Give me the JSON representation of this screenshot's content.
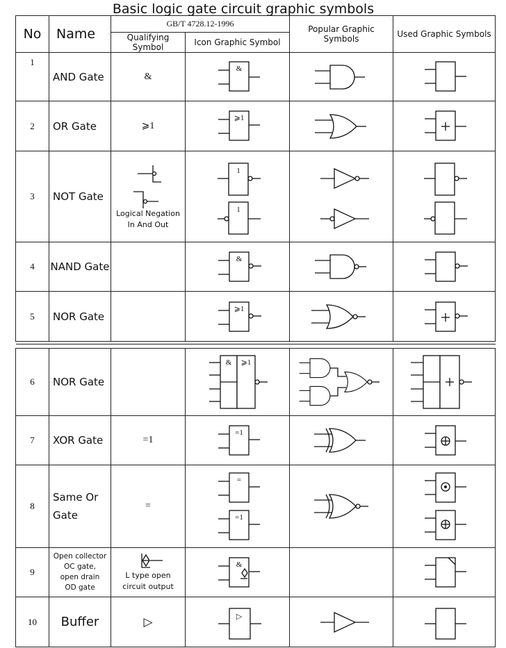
{
  "title": "Basic logic gate circuit graphic symbols",
  "header": {
    "no": "No",
    "name": "Name",
    "standard": "GB/T 4728.12-1996",
    "qualifying": "Qualifying Symbol",
    "icon": "Icon Graphic Symbol",
    "popular": "Popular Graphic Symbols",
    "used": "Used Graphic Symbols"
  },
  "rows": [
    {
      "no": "1",
      "name": "AND Gate",
      "qual": "&"
    },
    {
      "no": "2",
      "name": "OR Gate",
      "qual": "⩾1"
    },
    {
      "no": "3",
      "name": "NOT Gate",
      "qual": "",
      "note1": "Logical Negation",
      "note2": "In And Out"
    },
    {
      "no": "4",
      "name": "NAND Gate",
      "qual": ""
    },
    {
      "no": "5",
      "name": "NOR Gate",
      "qual": ""
    },
    {
      "no": "6",
      "name": "NOR Gate",
      "qual": ""
    },
    {
      "no": "7",
      "name": "XOR Gate",
      "qual": "=1"
    },
    {
      "no": "8",
      "name1": "Same Or",
      "name2": "Gate",
      "qual": "="
    },
    {
      "no": "9",
      "name1": "Open collector",
      "name2": "OC gate,",
      "name3": "open drain",
      "name4": "OD gate",
      "qual": "",
      "note1": "L type open",
      "note2": "circuit output"
    },
    {
      "no": "10",
      "name": "Buffer",
      "qual": "▷"
    }
  ],
  "symbol_text": {
    "and": "&",
    "or": "⩾1",
    "not": "1",
    "xor": "=1",
    "xnor": "=",
    "buffer": "▷"
  }
}
